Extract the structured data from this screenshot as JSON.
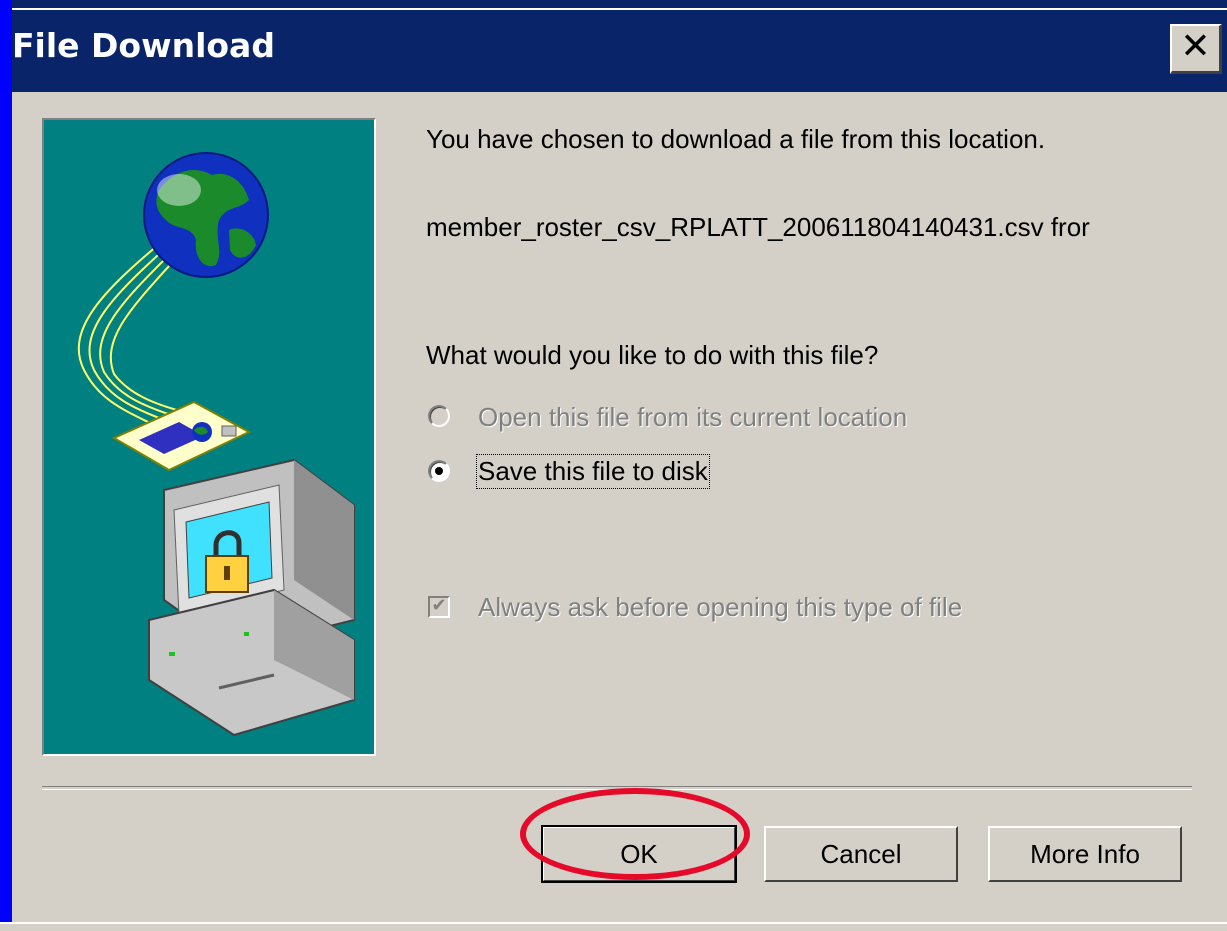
{
  "window": {
    "title": "File Download",
    "close_symbol": "✕",
    "title_bar_color": "#0a246a"
  },
  "message": {
    "intro": "You have chosen to download a file from this location.",
    "filename": "member_roster_csv_RPLATT_200611804140431.csv fror",
    "question": "What would you like to do with this file?"
  },
  "options": {
    "open_label": "Open this file from its current location",
    "open_selected": false,
    "open_enabled": false,
    "save_label": "Save this file to disk",
    "save_selected": true
  },
  "always_ask": {
    "label": "Always ask before opening this type of file",
    "checked": true,
    "enabled": false
  },
  "buttons": {
    "ok": "OK",
    "cancel": "Cancel",
    "more_info": "More Info"
  },
  "illustration": {
    "icons": [
      "globe-icon",
      "document-icon",
      "computer-icon",
      "padlock-icon"
    ],
    "background_color": "#008080"
  },
  "annotation": {
    "highlight_color": "#e60a2a",
    "target": "ok-button"
  }
}
